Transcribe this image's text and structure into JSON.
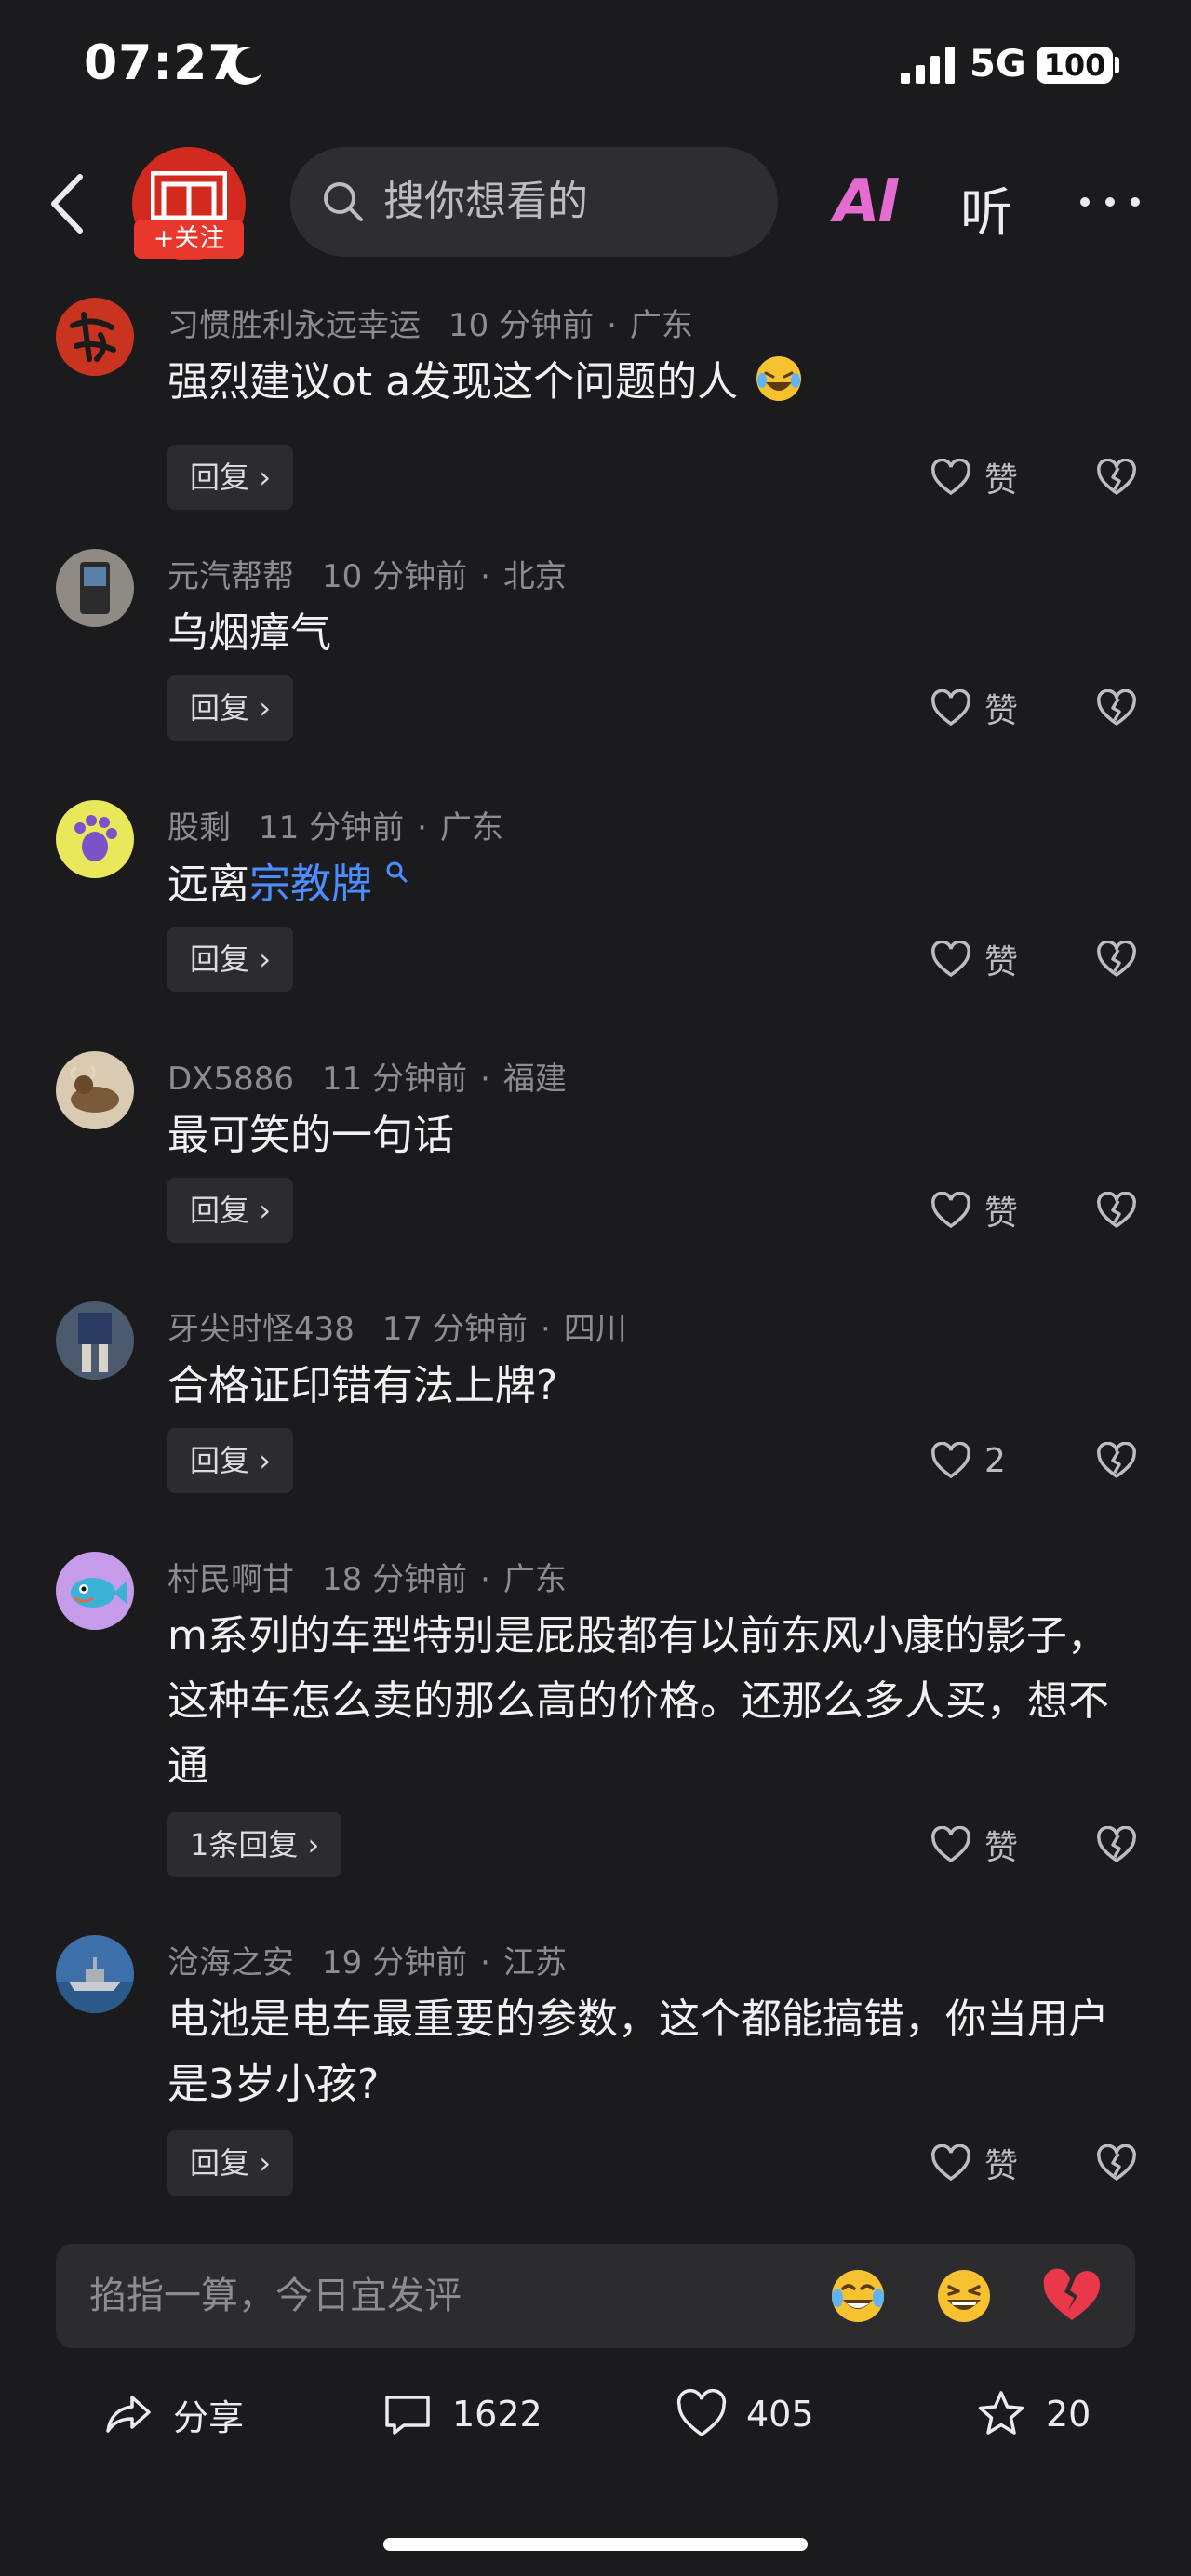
{
  "status_bar": {
    "time": "07:27",
    "network": "5G",
    "battery": "100"
  },
  "header": {
    "follow_label": "+关注",
    "search_placeholder": "搜你想看的",
    "ai_label": "AI",
    "listen_label": "听"
  },
  "comments": [
    {
      "user": "习惯胜利永远幸运",
      "time": "10 分钟前",
      "location": "广东",
      "text": "强烈建议ot a发现这个问题的人",
      "reply_label": "回复",
      "like_label": "赞"
    },
    {
      "user": "元汽帮帮",
      "time": "10 分钟前",
      "location": "北京",
      "text": "乌烟瘴气",
      "reply_label": "回复",
      "like_label": "赞"
    },
    {
      "user": "股剩",
      "time": "11 分钟前",
      "location": "广东",
      "text_prefix": "远离",
      "text_link": "宗教牌",
      "reply_label": "回复",
      "like_label": "赞"
    },
    {
      "user": "DX5886",
      "time": "11 分钟前",
      "location": "福建",
      "text": "最可笑的一句话",
      "reply_label": "回复",
      "like_label": "赞"
    },
    {
      "user": "牙尖时怪438",
      "time": "17 分钟前",
      "location": "四川",
      "text": "合格证印错有法上牌?",
      "reply_label": "回复",
      "like_label": "2"
    },
    {
      "user": "村民啊甘",
      "time": "18 分钟前",
      "location": "广东",
      "text": "m系列的车型特别是屁股都有以前东风小康的影子，这种车怎么卖的那么高的价格。还那么多人买，想不通",
      "reply_label": "1条回复",
      "like_label": "赞"
    },
    {
      "user": "沧海之安",
      "time": "19 分钟前",
      "location": "江苏",
      "text": "电池是电车最重要的参数，这个都能搞错，你当用户是3岁小孩?",
      "reply_label": "回复",
      "like_label": "赞"
    }
  ],
  "input_bar": {
    "placeholder": "掐指一算，今日宜发评"
  },
  "actions": {
    "share": "分享",
    "comments": "1622",
    "likes": "405",
    "favorites": "20"
  }
}
